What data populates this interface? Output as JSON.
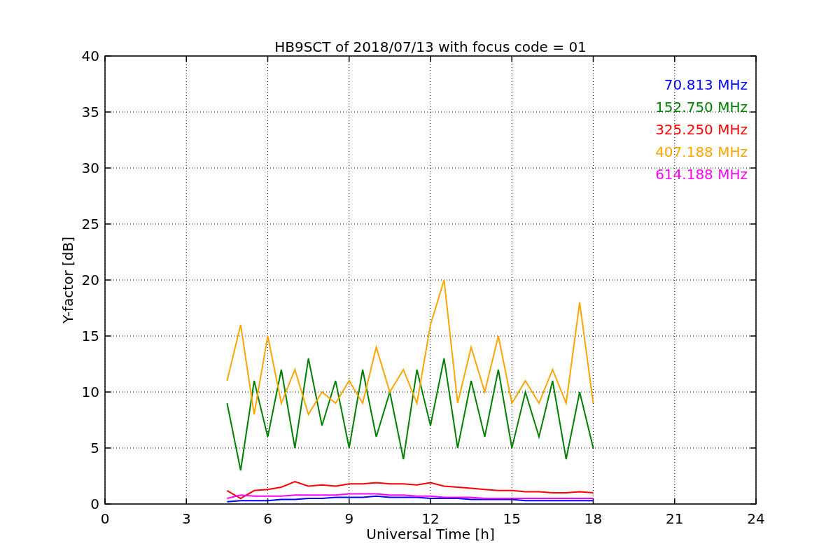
{
  "chart": {
    "chart_data": {
      "type": "line",
      "title": "HB9SCT of 2018/07/13 with focus code = 01",
      "xlabel": "Universal Time [h]",
      "ylabel": "Y-factor [dB]",
      "grid": true,
      "xlim": [
        0,
        24
      ],
      "ylim": [
        0,
        40
      ],
      "xticks": [
        0,
        3,
        6,
        9,
        12,
        15,
        18,
        21,
        24
      ],
      "yticks": [
        0,
        5,
        10,
        15,
        20,
        25,
        30,
        35,
        40
      ],
      "x": [
        4.5,
        5,
        5.5,
        6,
        6.5,
        7,
        7.5,
        8,
        8.5,
        9,
        9.5,
        10,
        10.5,
        11,
        11.5,
        12,
        12.5,
        13,
        13.5,
        14,
        14.5,
        15,
        15.5,
        16,
        16.5,
        17,
        17.5,
        18
      ],
      "series": [
        {
          "name": "70.813 MHz",
          "color": "#0000ff",
          "values": [
            0.2,
            0.3,
            0.3,
            0.3,
            0.4,
            0.4,
            0.5,
            0.5,
            0.6,
            0.6,
            0.6,
            0.7,
            0.6,
            0.6,
            0.6,
            0.5,
            0.5,
            0.5,
            0.4,
            0.4,
            0.4,
            0.4,
            0.3,
            0.3,
            0.3,
            0.3,
            0.3,
            0.3
          ]
        },
        {
          "name": "152.750 MHz",
          "color": "#008000",
          "values": [
            9,
            3,
            11,
            6,
            12,
            5,
            13,
            7,
            11,
            5,
            12,
            6,
            10,
            4,
            12,
            7,
            13,
            5,
            11,
            6,
            12,
            5,
            10,
            6,
            11,
            4,
            10,
            5
          ]
        },
        {
          "name": "325.250 MHz",
          "color": "#ff0000",
          "values": [
            1.2,
            0.5,
            1.2,
            1.3,
            1.5,
            2,
            1.6,
            1.7,
            1.6,
            1.8,
            1.8,
            1.9,
            1.8,
            1.8,
            1.7,
            1.9,
            1.6,
            1.5,
            1.4,
            1.3,
            1.2,
            1.2,
            1.1,
            1.1,
            1.0,
            1.0,
            1.1,
            1.0
          ]
        },
        {
          "name": "407.188 MHz",
          "color": "#ffa500",
          "values": [
            11,
            16,
            8,
            15,
            9,
            12,
            8,
            10,
            9,
            11,
            9,
            14,
            10,
            12,
            9,
            16,
            20,
            9,
            14,
            10,
            15,
            9,
            11,
            9,
            12,
            9,
            18,
            9
          ]
        },
        {
          "name": "614.188 MHz",
          "color": "#ff00ff",
          "values": [
            0.5,
            0.8,
            0.7,
            0.7,
            0.7,
            0.8,
            0.8,
            0.8,
            0.8,
            0.9,
            0.9,
            0.9,
            0.8,
            0.8,
            0.7,
            0.7,
            0.6,
            0.6,
            0.6,
            0.5,
            0.5,
            0.5,
            0.5,
            0.5,
            0.5,
            0.5,
            0.5,
            0.5
          ]
        }
      ]
    }
  }
}
